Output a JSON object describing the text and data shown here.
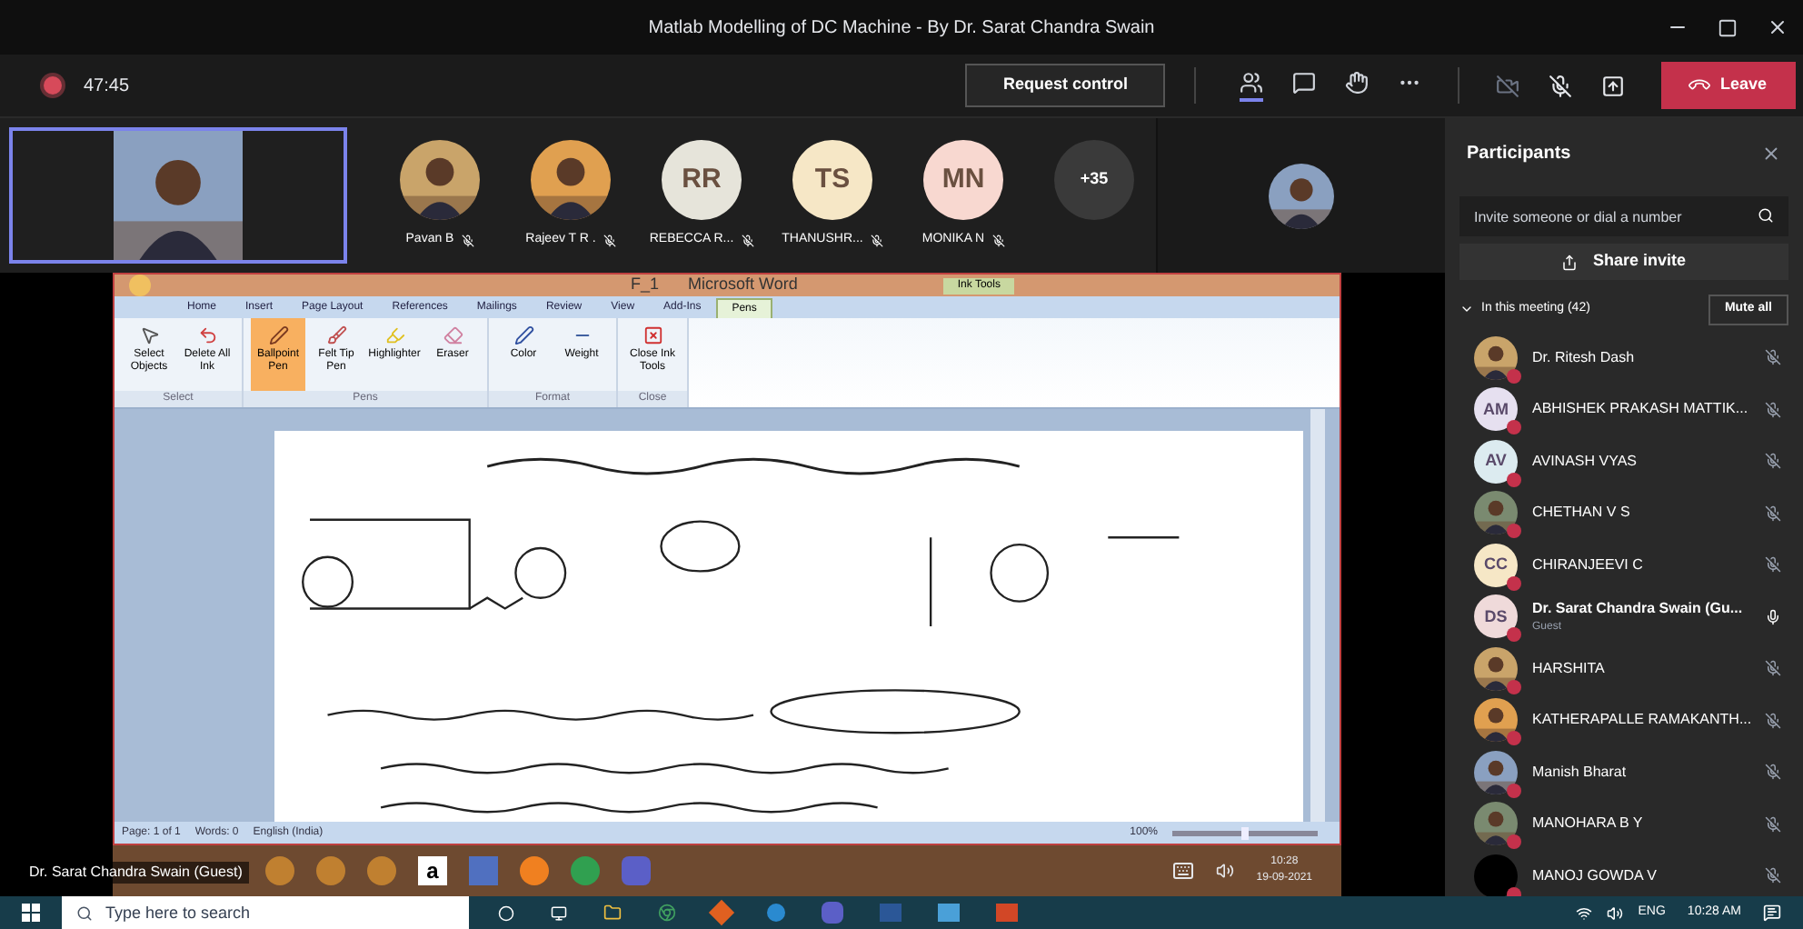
{
  "window": {
    "title": "Matlab Modelling of DC Machine - By Dr. Sarat Chandra Swain"
  },
  "meeting_bar": {
    "recording": true,
    "duration": "47:45",
    "request_control": "Request control",
    "tools": [
      {
        "kind": "people",
        "selected": true
      },
      {
        "kind": "chat",
        "selected": false
      },
      {
        "kind": "reactions",
        "selected": false
      },
      {
        "kind": "more",
        "selected": false
      }
    ],
    "leave": "Leave"
  },
  "video_strip": [
    {
      "name": "Pavan B",
      "muted": true
    },
    {
      "name": "Rajeev T R .",
      "muted": true
    },
    {
      "kind": "initials",
      "initials": "RR",
      "name": "REBECCA R...",
      "muted": true,
      "color": "#e6e4da"
    },
    {
      "kind": "initials",
      "initials": "TS",
      "name": "THANUSHR...",
      "muted": true,
      "color": "#f6e7c6"
    },
    {
      "kind": "initials",
      "initials": "MN",
      "name": "MONIKA N",
      "muted": true,
      "color": "#f8d8d0"
    },
    {
      "kind": "overflow",
      "initials": "+35"
    }
  ],
  "shared_screen": {
    "document": "F_1",
    "app": "Microsoft Word",
    "context_tab": "Ink Tools",
    "tabs": [
      {
        "label": "Home",
        "selected": false
      },
      {
        "label": "Insert",
        "selected": false
      },
      {
        "label": "Page Layout",
        "selected": false
      },
      {
        "label": "References",
        "selected": false
      },
      {
        "label": "Mailings",
        "selected": false
      },
      {
        "label": "Review",
        "selected": false
      },
      {
        "label": "View",
        "selected": false
      },
      {
        "label": "Add-Ins",
        "selected": false
      },
      {
        "label": "Pens",
        "selected": true
      }
    ],
    "groups": [
      {
        "name": "Select",
        "tools": [
          {
            "kind": "pointer",
            "label": "Select Objects",
            "selected": false
          },
          {
            "kind": "undo",
            "label": "Delete All Ink",
            "selected": false
          }
        ]
      },
      {
        "name": "Pens",
        "tools": [
          {
            "kind": "pen",
            "label": "Ballpoint Pen",
            "selected": true
          },
          {
            "kind": "felt",
            "label": "Felt Tip Pen",
            "selected": false
          },
          {
            "kind": "marker",
            "label": "Highlighter",
            "selected": false
          },
          {
            "kind": "eraser",
            "label": "Eraser",
            "selected": false
          }
        ]
      },
      {
        "name": "Format",
        "tools": [
          {
            "kind": "color",
            "label": "Color",
            "selected": false
          },
          {
            "kind": "weight",
            "label": "Weight",
            "selected": false
          }
        ]
      },
      {
        "name": "Close",
        "tools": [
          {
            "kind": "close",
            "label": "Close Ink Tools",
            "selected": false
          }
        ]
      }
    ],
    "status": [
      "Page: 1 of 1",
      "Words: 0",
      "English (India)"
    ],
    "zoom": "100%",
    "zoom_slider": {
      "level": 0.5
    },
    "taskbar_logo": "a",
    "clock_time": "10:28",
    "clock_date": "19-09-2021"
  },
  "presenter_label": "Dr. Sarat Chandra Swain (Guest)",
  "participants_panel": {
    "title": "Participants",
    "invite_placeholder": "Invite someone or dial a number",
    "share_invite": "Share invite",
    "section": "In this meeting (42)",
    "expanded": true,
    "mute_all": "Mute all",
    "people": [
      {
        "name": "Dr. Ritesh Dash",
        "muted": true
      },
      {
        "kind": "initials",
        "initials": "AM",
        "name": "ABHISHEK PRAKASH MATTIK...",
        "muted": true,
        "color": "#e6e0f0"
      },
      {
        "kind": "initials",
        "initials": "AV",
        "name": "AVINASH VYAS",
        "muted": true,
        "color": "#dcebf0"
      },
      {
        "name": "CHETHAN V S",
        "muted": true
      },
      {
        "kind": "initials",
        "initials": "CC",
        "name": "CHIRANJEEVI C",
        "muted": true,
        "color": "#f6e7c6"
      },
      {
        "kind": "initials",
        "initials": "DS",
        "name": "Dr. Sarat Chandra Swain (Gu...",
        "role": "Guest",
        "muted": false,
        "color": "#efdada"
      },
      {
        "name": "HARSHITA",
        "muted": true
      },
      {
        "name": "KATHERAPALLE RAMAKANTH...",
        "muted": true
      },
      {
        "name": "Manish Bharat",
        "muted": true
      },
      {
        "name": "MANOHARA B Y",
        "muted": true
      },
      {
        "kind": "dark",
        "name": "MANOJ GOWDA V",
        "muted": true
      }
    ]
  },
  "taskbar": {
    "search_placeholder": "Type here to search",
    "language": "ENG",
    "time": "10:28 AM"
  }
}
